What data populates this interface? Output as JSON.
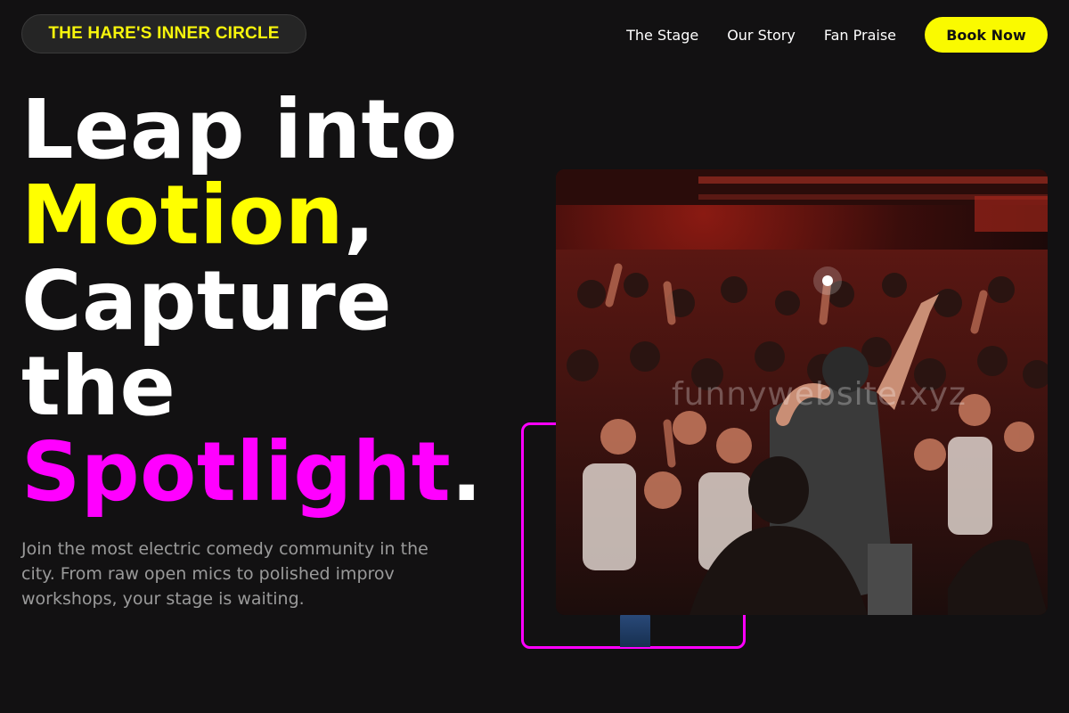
{
  "header": {
    "brand": "THE HARE'S INNER CIRCLE",
    "nav": [
      "The Stage",
      "Our Story",
      "Fan Praise"
    ],
    "cta": "Book Now"
  },
  "hero": {
    "title_line1": "Leap into",
    "title_word2": "Motion",
    "title_punct2": ",",
    "title_line3": "Capture",
    "title_line4": "the",
    "title_word5": "Spotlight",
    "title_punct5": ".",
    "subtitle": "Join the most electric comedy community in the city. From raw open mics to polished improv workshops, your stage is waiting."
  },
  "image": {
    "watermark": "funnywebsite.xyz"
  },
  "colors": {
    "background": "#121112",
    "accent_yellow": "#ffff00",
    "accent_magenta": "#ff00ff",
    "brand_text": "#f7f50c"
  }
}
